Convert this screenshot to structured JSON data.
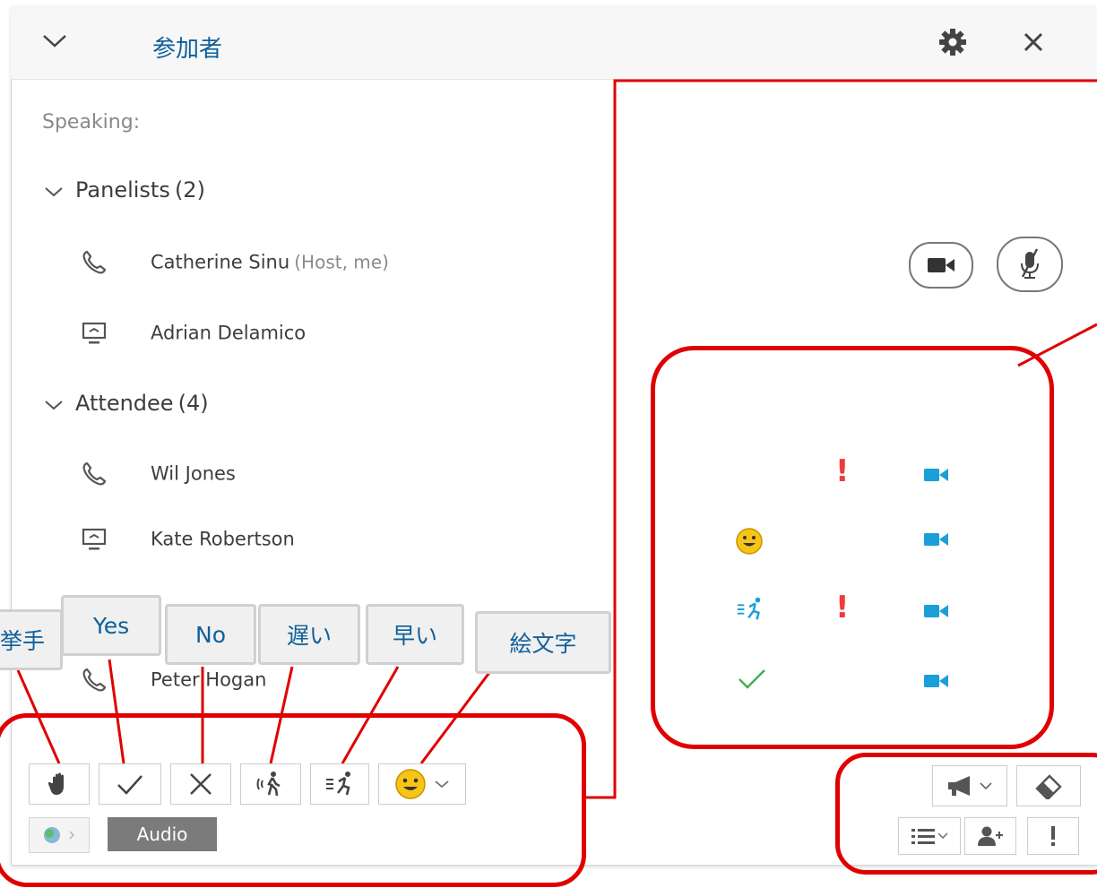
{
  "header": {
    "title": "参加者",
    "collapse_icon": "chevron-down-icon",
    "settings_icon": "gear-icon",
    "close_icon": "close-icon"
  },
  "participants": {
    "speaking_label": "Speaking:",
    "groups": [
      {
        "label": "Panelists",
        "count": "(2)",
        "members": [
          {
            "name": "Catherine Sinu",
            "role": "(Host, me)",
            "icon": "phone-icon"
          },
          {
            "name": "Adrian Delamico",
            "role": "",
            "icon": "screen-icon"
          }
        ]
      },
      {
        "label": "Attendee",
        "count": "(4)",
        "members": [
          {
            "name": "Wil Jones",
            "role": "",
            "icon": "phone-icon"
          },
          {
            "name": "Kate Robertson",
            "role": "",
            "icon": "screen-icon"
          },
          {
            "name": "Peter Hogan",
            "role": "",
            "icon": "phone-icon"
          }
        ]
      }
    ]
  },
  "callouts": {
    "raise_hand": "挙手",
    "yes": "Yes",
    "no": "No",
    "slow": "遅い",
    "fast": "早い",
    "emoji": "絵文字"
  },
  "feedback_toolbar": {
    "icons": [
      "raise-hand-icon",
      "check-icon",
      "x-icon",
      "slower-icon",
      "faster-icon",
      "emoji-icon"
    ],
    "audio_label": "Audio"
  },
  "colors": {
    "accent": "#0f5f9a",
    "annotation_red": "#e00000",
    "video_blue": "#1a9fd8",
    "alert_red": "#f03a3a",
    "check_green": "#3fae49"
  }
}
